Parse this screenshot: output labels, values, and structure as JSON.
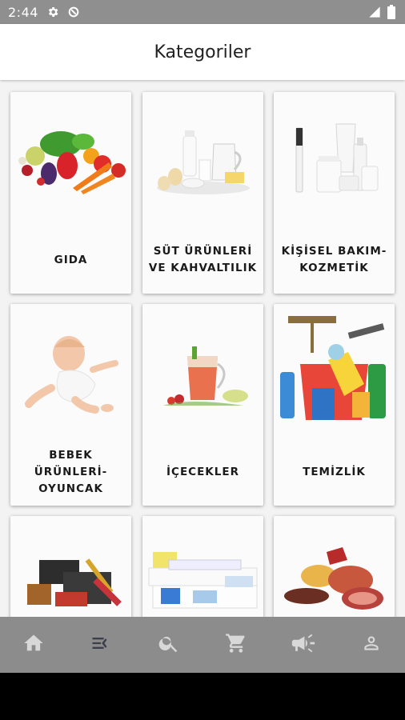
{
  "status_bar": {
    "time": "2:44"
  },
  "header": {
    "title": "Kategoriler"
  },
  "categories": [
    {
      "label": "GIDA",
      "icon": "vegetables-image"
    },
    {
      "label": "SÜT ÜRÜNLERİ VE KAHVALTILIK",
      "icon": "dairy-image"
    },
    {
      "label": "KİŞİSEL BAKIM-KOZMETİK",
      "icon": "cosmetics-image"
    },
    {
      "label": "BEBEK ÜRÜNLERİ-OYUNCAK",
      "icon": "baby-image"
    },
    {
      "label": "İÇECEKLER",
      "icon": "drinks-image"
    },
    {
      "label": "TEMİZLİK",
      "icon": "cleaning-image"
    },
    {
      "label": "",
      "icon": "tools-image"
    },
    {
      "label": "",
      "icon": "paper-products-image"
    },
    {
      "label": "",
      "icon": "meat-image"
    }
  ],
  "bottom_nav": [
    {
      "name": "home",
      "icon": "home-icon",
      "active": false
    },
    {
      "name": "categories",
      "icon": "category-list-icon",
      "active": true
    },
    {
      "name": "search",
      "icon": "search-icon",
      "active": false
    },
    {
      "name": "cart",
      "icon": "cart-icon",
      "active": false
    },
    {
      "name": "campaigns",
      "icon": "megaphone-icon",
      "active": false
    },
    {
      "name": "profile",
      "icon": "profile-icon",
      "active": false
    }
  ],
  "colors": {
    "status_bar": "#8f8f8f",
    "bottom_nav": "#8c8c8c",
    "nav_icon": "#d8d8d8",
    "nav_icon_active": "#3a3f4a"
  }
}
